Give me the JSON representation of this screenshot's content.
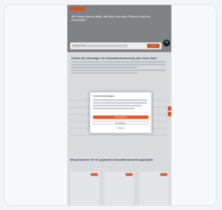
{
  "preview": {
    "hero": {
      "headline": "Wir sorgen gerne dafür, daß Sie's bei allen Themen rund um Immobilien",
      "search_placeholder": "Suchbegriff eingeben",
      "search_button": "Suchen"
    },
    "section_heading": "Finden Sie Unterlagen für Immobilienbewertung oder einen Kauf",
    "lower_heading": "Wissenswertes für Ihr geplantes Immobilienbewertungsprojekt",
    "cookie_dialog": {
      "title": "Cookie-Einstellungen",
      "accept_label": "Alle akzeptieren",
      "settings_label": "Einstellungen",
      "decline_label": "Ablehnen"
    }
  },
  "colors": {
    "accent": "#e85a2a",
    "card_bg": "#f7f9fc",
    "page_bg": "#f2f4f7"
  }
}
